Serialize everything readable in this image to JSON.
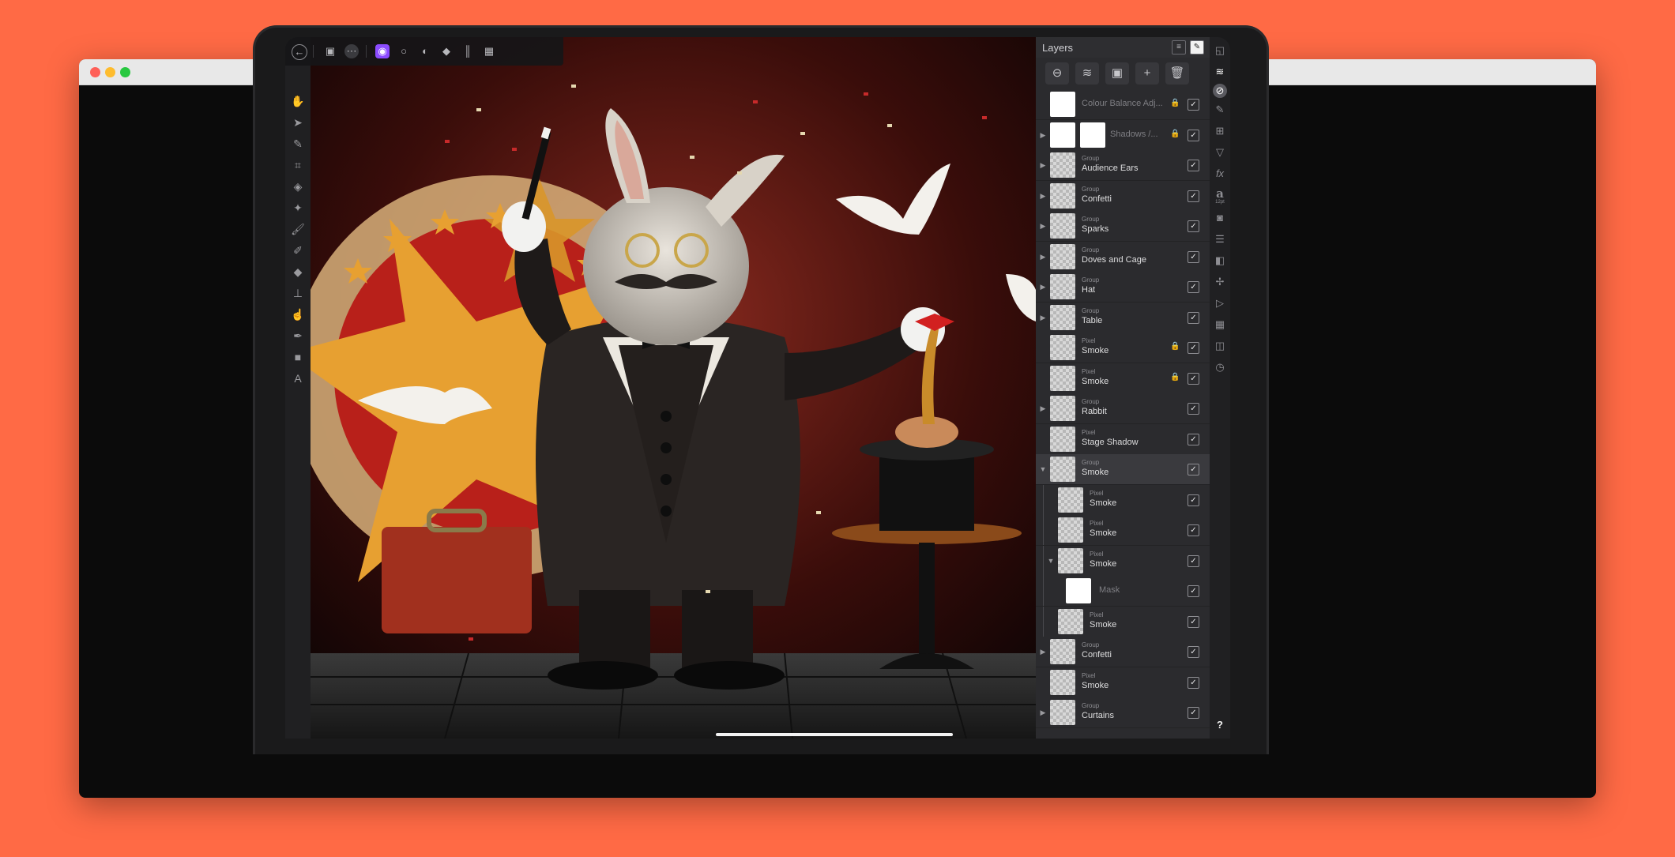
{
  "window": {
    "traffic_lights": [
      "close",
      "minimize",
      "zoom"
    ]
  },
  "toolbar": {
    "icons": [
      "back-arrow-icon",
      "document-icon",
      "more-icon",
      "persona-photo-icon",
      "circle-icon",
      "liquify-icon",
      "develop-icon",
      "tone-map-icon",
      "export-icon"
    ]
  },
  "tools": [
    "hand-icon",
    "move-icon",
    "color-picker-icon",
    "crop-icon",
    "selection-brush-icon",
    "flood-select-icon",
    "paint-brush-icon",
    "erase-brush-icon",
    "dodge-icon",
    "clone-icon",
    "smudge-icon",
    "pen-icon",
    "rectangle-icon",
    "text-icon"
  ],
  "layers_panel": {
    "title": "Layers",
    "action_icons": [
      "blend-mode-icon",
      "layer-stack-icon",
      "mask-icon",
      "add-icon",
      "trash-icon"
    ],
    "layers": [
      {
        "type": "",
        "name": "Colour Balance Adj...",
        "locked": true,
        "visible": true,
        "expandable": false
      },
      {
        "type": "",
        "name": "Shadows /...",
        "locked": true,
        "visible": true,
        "expandable": true
      },
      {
        "type": "Group",
        "name": "Audience Ears",
        "locked": false,
        "visible": true,
        "expandable": true
      },
      {
        "type": "Group",
        "name": "Confetti",
        "locked": false,
        "visible": true,
        "expandable": true
      },
      {
        "type": "Group",
        "name": "Sparks",
        "locked": false,
        "visible": true,
        "expandable": true
      },
      {
        "type": "Group",
        "name": "Doves and Cage",
        "locked": false,
        "visible": true,
        "expandable": true
      },
      {
        "type": "Group",
        "name": "Hat",
        "locked": false,
        "visible": true,
        "expandable": true
      },
      {
        "type": "Group",
        "name": "Table",
        "locked": false,
        "visible": true,
        "expandable": true
      },
      {
        "type": "Pixel",
        "name": "Smoke",
        "locked": true,
        "visible": true,
        "expandable": false
      },
      {
        "type": "Pixel",
        "name": "Smoke",
        "locked": true,
        "visible": true,
        "expandable": false
      },
      {
        "type": "Group",
        "name": "Rabbit",
        "locked": false,
        "visible": true,
        "expandable": true
      },
      {
        "type": "Pixel",
        "name": "Stage Shadow",
        "locked": false,
        "visible": true,
        "expandable": false
      },
      {
        "type": "Group",
        "name": "Smoke",
        "locked": false,
        "visible": true,
        "expandable": true,
        "expanded": true,
        "selected": true
      },
      {
        "type": "Pixel",
        "name": "Smoke",
        "locked": false,
        "visible": true,
        "expandable": false,
        "child": true
      },
      {
        "type": "Pixel",
        "name": "Smoke",
        "locked": false,
        "visible": true,
        "expandable": false,
        "child": true
      },
      {
        "type": "Pixel",
        "name": "Smoke",
        "locked": false,
        "visible": true,
        "expandable": true,
        "expanded": true,
        "child": true
      },
      {
        "type": "",
        "name": "Mask",
        "locked": false,
        "visible": true,
        "expandable": false,
        "child": true,
        "mask": true
      },
      {
        "type": "Pixel",
        "name": "Smoke",
        "locked": false,
        "visible": true,
        "expandable": false,
        "child": true
      },
      {
        "type": "Group",
        "name": "Confetti",
        "locked": false,
        "visible": true,
        "expandable": true
      },
      {
        "type": "Pixel",
        "name": "Smoke",
        "locked": false,
        "visible": true,
        "expandable": false
      },
      {
        "type": "Group",
        "name": "Curtains",
        "locked": false,
        "visible": true,
        "expandable": true
      }
    ]
  },
  "right_studio": {
    "icons": [
      "navigator-icon",
      "layers-icon",
      "brushes-icon",
      "color-icon",
      "transform-icon",
      "filters-icon",
      "fx-icon",
      "text-style-icon",
      "snapshot-icon",
      "adjustments-icon",
      "channels-icon",
      "stroke-icon",
      "macro-icon",
      "grid-icon",
      "history-icon",
      "help-icon"
    ],
    "text_label": "12pt",
    "help_label": "?"
  },
  "canvas": {
    "description_colors": {
      "background": "#3d0c0a",
      "star_gold": "#e7a031",
      "star_red": "#b8201a"
    }
  },
  "colors": {
    "page_bg": "#ff6a45",
    "panel_bg": "#2b2b2e",
    "accent": "#8c4cff"
  }
}
